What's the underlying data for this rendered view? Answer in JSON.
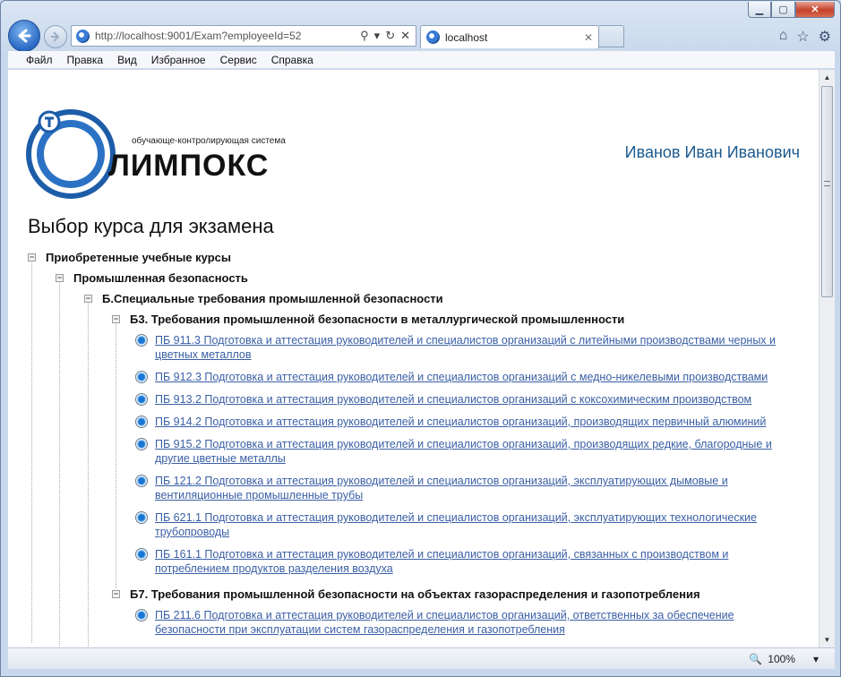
{
  "browser": {
    "address": "http://localhost:9001/Exam?employeeId=52",
    "tab_title": "localhost",
    "menu": [
      "Файл",
      "Правка",
      "Вид",
      "Избранное",
      "Сервис",
      "Справка"
    ],
    "zoom": "100%"
  },
  "page": {
    "logo_subtitle": "обучающе-контролирующая система",
    "logo_name": "ЛИМПОКС",
    "user_name": "Иванов Иван Иванович",
    "title": "Выбор курса для экзамена"
  },
  "tree": {
    "root": "Приобретенные учебные курсы",
    "level1": "Промышленная безопасность",
    "level2": "Б.Специальные требования промышленной безопасности",
    "group1": {
      "label": "Б3. Требования промышленной безопасности в металлургической промышленности",
      "items": [
        [
          "ПБ 911.3 Подготовка и аттестация руководителей и специалистов организаций с литейными производствами черных и",
          "цветных металлов"
        ],
        [
          "ПБ 912.3 Подготовка и аттестация руководителей и специалистов организаций с медно-никелевыми производствами"
        ],
        [
          "ПБ 913.2 Подготовка и аттестация руководителей и специалистов организаций с коксохимическим производством"
        ],
        [
          "ПБ 914.2 Подготовка и аттестация руководителей и специалистов организаций, производящих первичный алюминий"
        ],
        [
          "ПБ 915.2 Подготовка и аттестация руководителей и специалистов организаций, производящих редкие, благородные и",
          "другие цветные металлы"
        ],
        [
          "ПБ 121.2 Подготовка и аттестация руководителей и специалистов организаций, эксплуатирующих дымовые и",
          "вентиляционные промышленные трубы"
        ],
        [
          "ПБ 621.1 Подготовка и аттестация руководителей и специалистов организаций, эксплуатирующих технологические",
          "трубопроводы"
        ],
        [
          "ПБ 161.1 Подготовка и аттестация руководителей и специалистов организаций, связанных с производством и",
          "потреблением продуктов разделения воздуха"
        ]
      ]
    },
    "group2": {
      "label": "Б7. Требования промышленной безопасности на объектах газораспределения и газопотребления",
      "items": [
        [
          "ПБ 211.6 Подготовка и аттестация руководителей и специалистов организаций, ответственных за обеспечение",
          "безопасности при эксплуатации систем газораспределения и газопотребления"
        ]
      ]
    }
  }
}
